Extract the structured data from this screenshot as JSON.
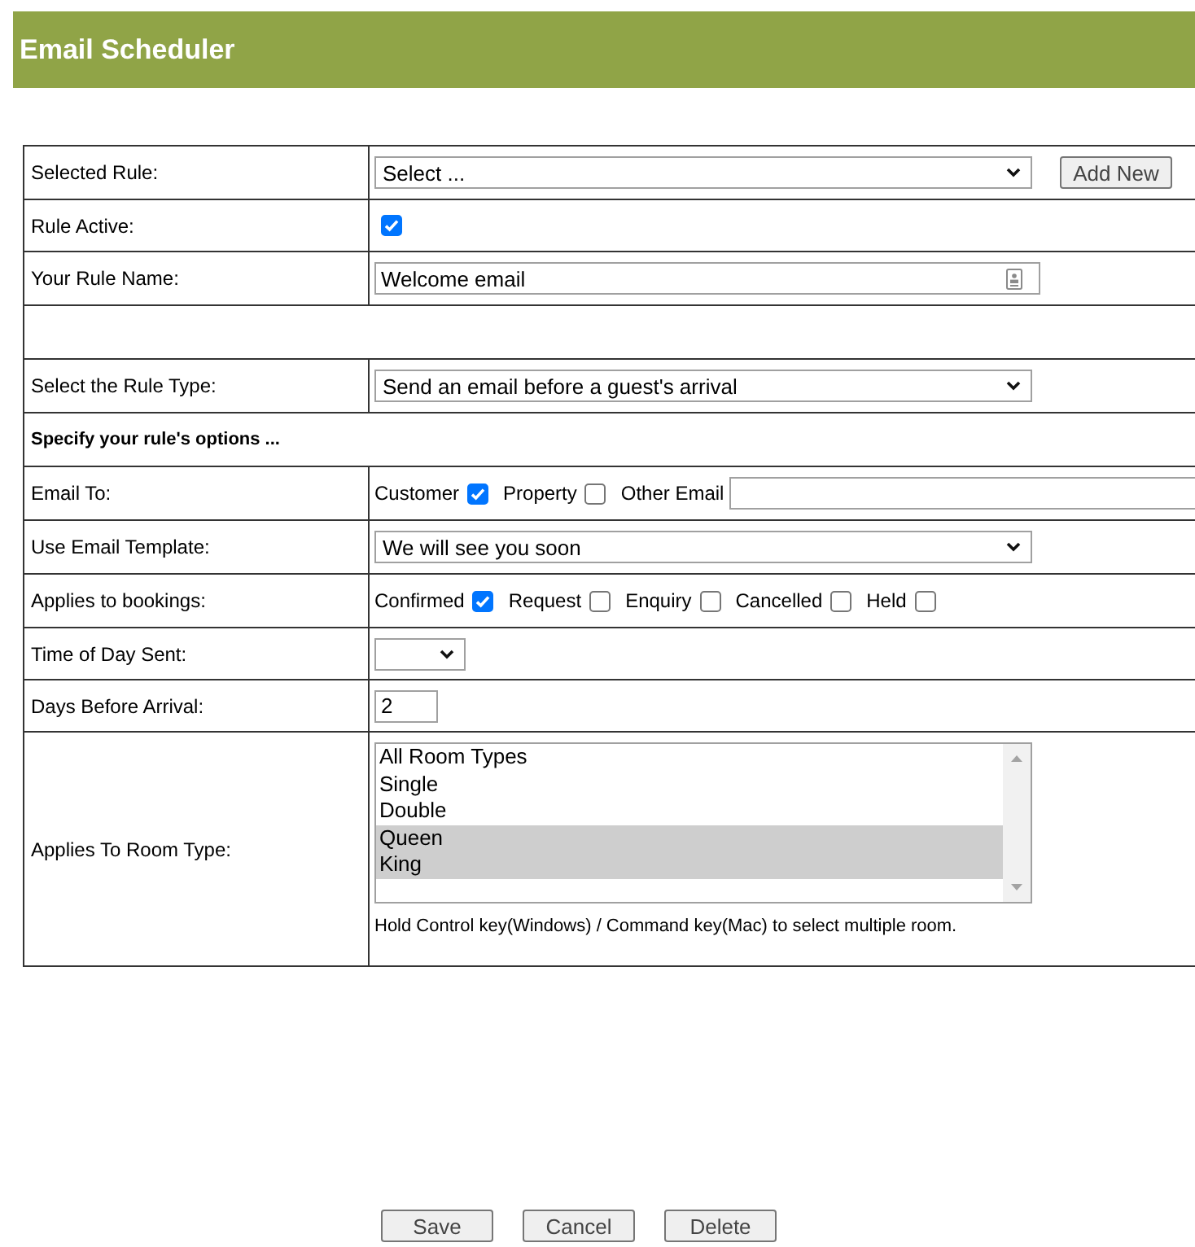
{
  "header": {
    "title": "Email Scheduler"
  },
  "form": {
    "rows": [
      {
        "kind": "select",
        "label": "Selected Rule:",
        "value": "Select ...",
        "button": "Add New"
      },
      {
        "kind": "checkbox",
        "label": "Rule Active:",
        "checked": true
      },
      {
        "kind": "text",
        "label": "Your Rule Name:",
        "value": "Welcome email"
      },
      {
        "kind": "blank"
      },
      {
        "kind": "select",
        "label": "Select the Rule Type:",
        "value": "Send an email before a guest's arrival"
      },
      {
        "kind": "section",
        "label": "Specify your rule's options ..."
      },
      {
        "kind": "options",
        "label": "Email To:",
        "options": [
          {
            "kind": "checkbox",
            "label": "Customer",
            "checked": true
          },
          {
            "kind": "checkbox",
            "label": "Property",
            "checked": false
          },
          {
            "kind": "text",
            "label": "Other Email"
          }
        ]
      },
      {
        "kind": "select",
        "label": "Use Email Template:",
        "value": "We will see you soon"
      },
      {
        "kind": "options",
        "label": "Applies to bookings:",
        "options": [
          {
            "kind": "checkbox",
            "label": "Confirmed",
            "checked": true
          },
          {
            "kind": "checkbox",
            "label": "Request",
            "checked": false
          },
          {
            "kind": "checkbox",
            "label": "Enquiry",
            "checked": false
          },
          {
            "kind": "checkbox",
            "label": "Cancelled",
            "checked": false
          },
          {
            "kind": "checkbox",
            "label": "Held",
            "checked": false
          }
        ]
      },
      {
        "kind": "small_select",
        "label": "Time of Day Sent:"
      },
      {
        "kind": "number",
        "label": "Days Before Arrival:",
        "value": "2"
      },
      {
        "kind": "listbox",
        "label": "Applies To Room Type:",
        "items": [
          {
            "label": "All Room Types",
            "selected": false
          },
          {
            "label": "Single",
            "selected": false
          },
          {
            "label": "Double",
            "selected": false
          },
          {
            "label": "Queen",
            "selected": true
          },
          {
            "label": "King",
            "selected": true
          }
        ],
        "hint": "Hold Control key(Windows) / Command key(Mac) to select multiple room."
      }
    ]
  },
  "buttons": [
    {
      "label": "Save"
    },
    {
      "label": "Cancel"
    },
    {
      "label": "Delete"
    }
  ]
}
